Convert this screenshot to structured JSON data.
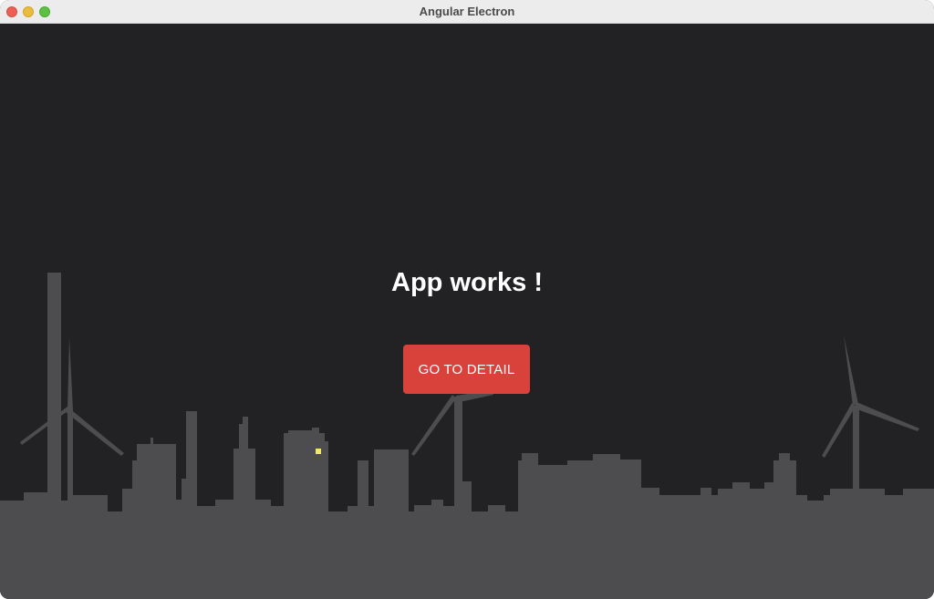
{
  "window": {
    "title": "Angular Electron"
  },
  "home": {
    "heading": "App works !",
    "detail_button_label": "GO TO DETAIL"
  },
  "colors": {
    "background": "#222123",
    "skyline": "#4d4c4f",
    "button": "#d9423a",
    "window_light": "#f1e769"
  }
}
